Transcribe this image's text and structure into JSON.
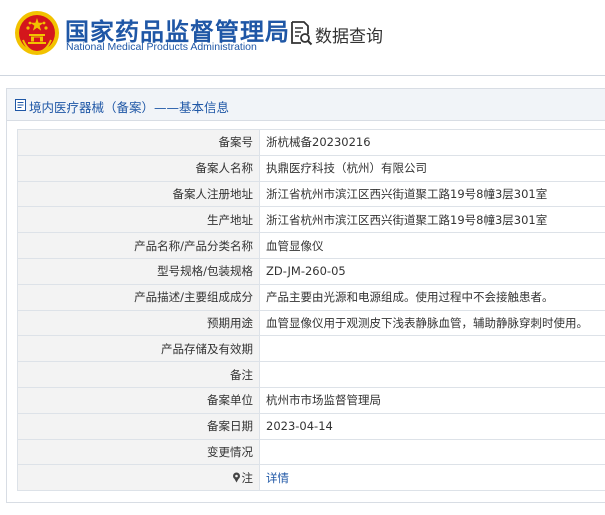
{
  "header": {
    "title_cn": "国家药品监督管理局",
    "title_en": "National Medical Products Administration",
    "query_label": "数据查询",
    "icons": {
      "emblem": "national-emblem-icon",
      "query": "document-search-icon"
    },
    "colors": {
      "brand": "#1f57a6",
      "emblem_red": "#d4161c",
      "emblem_gold": "#f2c200"
    }
  },
  "panel": {
    "title": "境内医疗器械（备案）——基本信息",
    "icon": "document-icon"
  },
  "details": [
    {
      "label": "备案号",
      "value": "浙杭械备20230216"
    },
    {
      "label": "备案人名称",
      "value": "执鼎医疗科技（杭州）有限公司"
    },
    {
      "label": "备案人注册地址",
      "value": "浙江省杭州市滨江区西兴街道聚工路19号8幢3层301室"
    },
    {
      "label": "生产地址",
      "value": "浙江省杭州市滨江区西兴街道聚工路19号8幢3层301室"
    },
    {
      "label": "产品名称/产品分类名称",
      "value": "血管显像仪"
    },
    {
      "label": "型号规格/包装规格",
      "value": "ZD-JM-260-05"
    },
    {
      "label": "产品描述/主要组成成分",
      "value": "产品主要由光源和电源组成。使用过程中不会接触患者。"
    },
    {
      "label": "预期用途",
      "value": "血管显像仪用于观测皮下浅表静脉血管，辅助静脉穿刺时使用。"
    },
    {
      "label": "产品存储及有效期",
      "value": ""
    },
    {
      "label": "备注",
      "value": ""
    },
    {
      "label": "备案单位",
      "value": "杭州市市场监督管理局"
    },
    {
      "label": "备案日期",
      "value": "2023-04-14"
    },
    {
      "label": "变更情况",
      "value": ""
    }
  ],
  "note": {
    "label": "注",
    "icon": "pin-icon",
    "link_text": "详情"
  }
}
